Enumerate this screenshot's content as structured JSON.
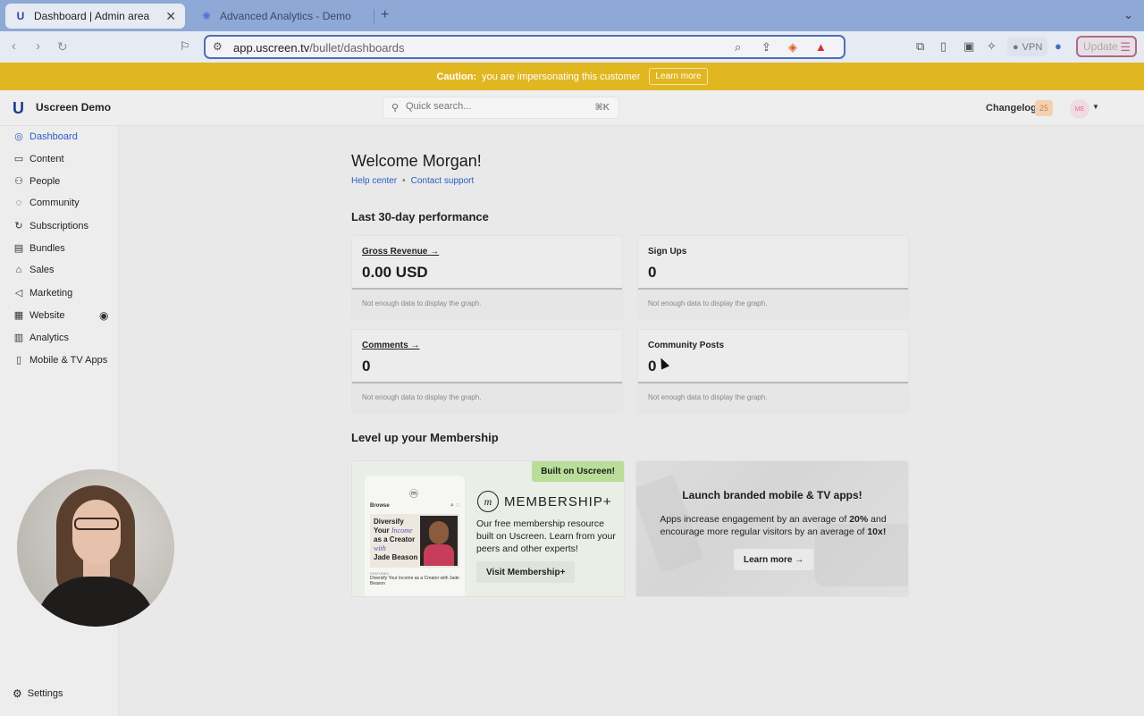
{
  "browser": {
    "tabs": [
      {
        "title": "Dashboard | Admin area",
        "favicon": "U"
      },
      {
        "title": "Advanced Analytics - Demo",
        "favicon": "✺"
      }
    ],
    "url_host": "app.uscreen.tv",
    "url_path": "/bullet/dashboards",
    "vpn_label": "VPN",
    "update_label": "Update"
  },
  "banner": {
    "caution_label": "Caution:",
    "message": "you are impersonating this customer",
    "learn_more": "Learn more"
  },
  "header": {
    "brand": "Uscreen Demo",
    "search_placeholder": "Quick search...",
    "search_shortcut": "⌘K",
    "changelog_label": "Changelog",
    "changelog_count": "25",
    "avatar_initials": "ME"
  },
  "sidebar": {
    "items": [
      {
        "label": "Dashboard",
        "icon": "dashboard-icon"
      },
      {
        "label": "Content",
        "icon": "folder-icon"
      },
      {
        "label": "People",
        "icon": "people-icon"
      },
      {
        "label": "Community",
        "icon": "community-icon"
      },
      {
        "label": "Subscriptions",
        "icon": "refresh-icon"
      },
      {
        "label": "Bundles",
        "icon": "bundle-icon"
      },
      {
        "label": "Sales",
        "icon": "bank-icon"
      },
      {
        "label": "Marketing",
        "icon": "megaphone-icon"
      },
      {
        "label": "Website",
        "icon": "website-icon"
      },
      {
        "label": "Analytics",
        "icon": "bar-chart-icon"
      },
      {
        "label": "Mobile & TV Apps",
        "icon": "devices-icon"
      }
    ],
    "settings_label": "Settings"
  },
  "main": {
    "welcome": "Welcome Morgan!",
    "help_center": "Help center",
    "contact_support": "Contact support",
    "performance_title": "Last 30-day performance",
    "cards": [
      {
        "label": "Gross Revenue →",
        "value": "0.00 USD",
        "note": "Not enough data to display the graph."
      },
      {
        "label": "Sign Ups",
        "value": "0",
        "note": "Not enough data to display the graph."
      },
      {
        "label": "Comments →",
        "value": "0",
        "note": "Not enough data to display the graph."
      },
      {
        "label": "Community Posts",
        "value": "0",
        "note": "Not enough data to display the graph."
      }
    ],
    "levelup_title": "Level up your Membership",
    "membership_promo": {
      "badge": "Built on Uscreen!",
      "logo_text": "MEMBERSHIP+",
      "description": "Our free membership resource built on Uscreen. Learn from your peers and other experts!",
      "button": "Visit Membership+",
      "phone_browse": "Browse",
      "phone_card_line1": "Diversify",
      "phone_card_line2": "Your",
      "phone_card_italic1": "Income",
      "phone_card_line3": "as a Creator",
      "phone_card_italic2": "with",
      "phone_card_line4": "Jade Beason",
      "phone_featured": "FEATURED",
      "phone_caption": "Diversify Your Income as a Creator with Jade Beason"
    },
    "apps_promo": {
      "title": "Launch branded mobile & TV apps!",
      "desc_part1": "Apps increase engagement by an average of ",
      "desc_bold1": "20%",
      "desc_part2": " and encourage more regular visitors by an average of ",
      "desc_bold2": "10x!",
      "button": "Learn more →"
    }
  }
}
